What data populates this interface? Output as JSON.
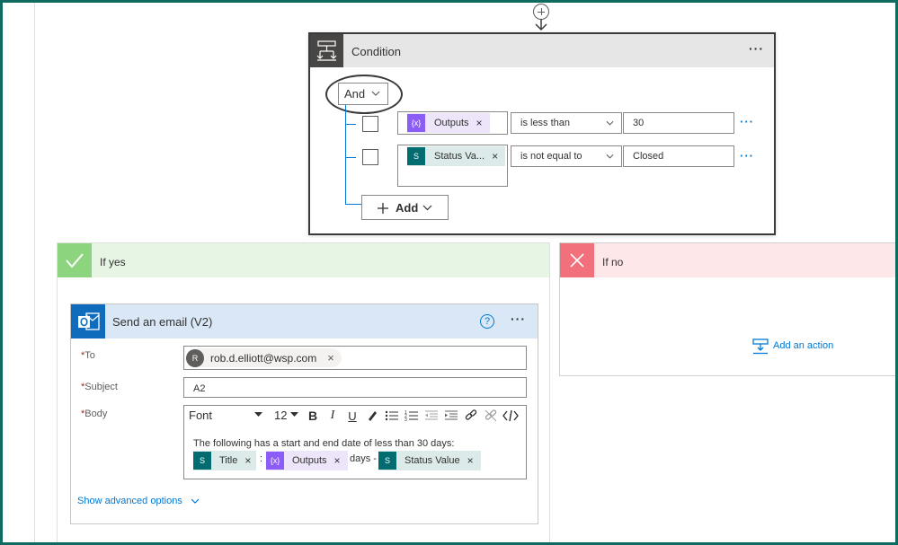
{
  "condition": {
    "title": "Condition",
    "more": "···",
    "group_operator": "And",
    "rows": [
      {
        "token": {
          "label": "Outputs",
          "icon": "variable-icon",
          "color": "#8b5cf6"
        },
        "operator": "is less than",
        "value": "30"
      },
      {
        "token": {
          "label": "Status Va...",
          "icon": "sharepoint-icon",
          "color": "#036c70"
        },
        "operator": "is not equal to",
        "value": "Closed"
      }
    ],
    "add_label": "Add",
    "row_more": "···"
  },
  "yes_branch": {
    "label": "If yes",
    "action": {
      "title": "Send an email (V2)",
      "help": "?",
      "more": "···",
      "to_label": "To",
      "to_avatar": "R",
      "to_value": "rob.d.elliott@wsp.com",
      "subject_label": "Subject",
      "subject_value": "A2",
      "body_label": "Body",
      "toolbar": {
        "font": "Font",
        "size": "12"
      },
      "body_text": "The following has a start and end date of less than 30 days:",
      "body_tokens": [
        {
          "label": "Title",
          "icon": "sharepoint-icon"
        },
        {
          "label": "Outputs",
          "icon": "variable-icon"
        },
        {
          "label": "Status Value",
          "icon": "sharepoint-icon"
        }
      ],
      "body_sep_colon": ":",
      "body_days": "days -",
      "show_advanced": "Show advanced options"
    }
  },
  "no_branch": {
    "label": "If no",
    "add_action": "Add an action"
  },
  "colors": {
    "frame": "#0f6b5f",
    "accent": "#0078d4",
    "yes_header": "#e7f5e5",
    "yes_icon": "#8dd47f",
    "no_header": "#fde7e9",
    "no_icon": "#f1707b",
    "outlook": "#0f6cbd",
    "sharepoint": "#036c70",
    "variable": "#8b5cf6"
  }
}
